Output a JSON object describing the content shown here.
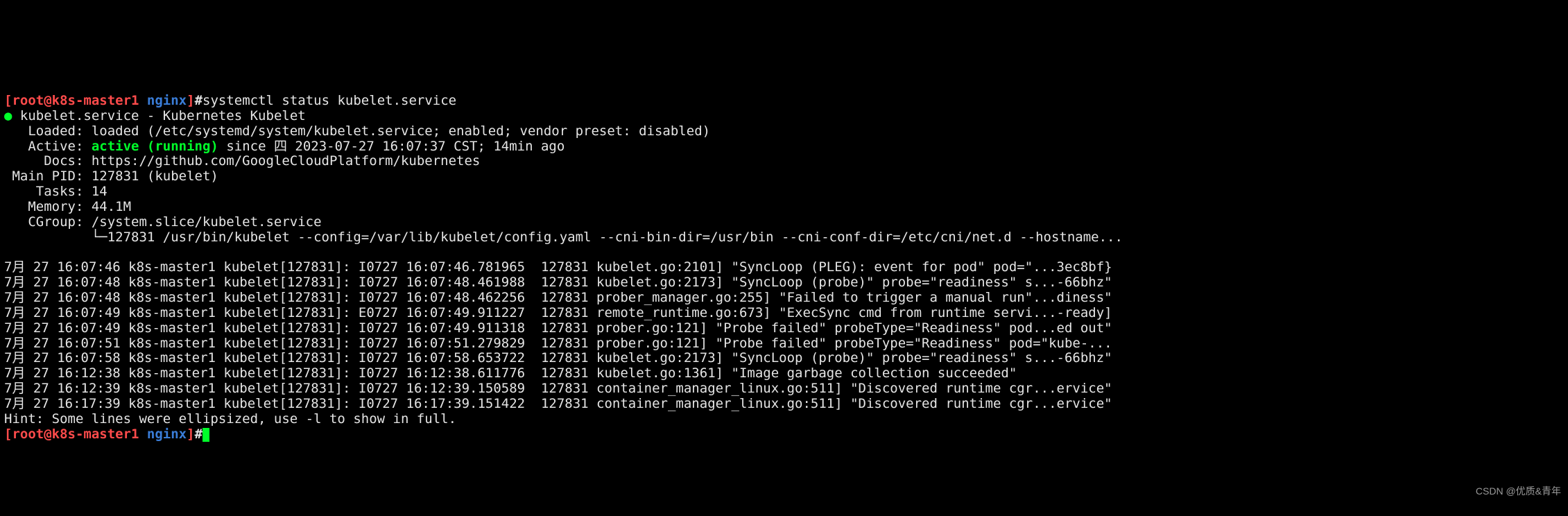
{
  "prompt": {
    "open": "[",
    "user_host": "root@k8s-master1",
    "cwd": " nginx",
    "close": "]",
    "hash": "#"
  },
  "command": "systemctl status kubelet.service",
  "status": {
    "bullet": "●",
    "service_header": " kubelet.service - Kubernetes Kubelet",
    "loaded_line": "   Loaded: loaded (/etc/systemd/system/kubelet.service; enabled; vendor preset: disabled)",
    "active_prefix": "   Active: ",
    "active_value": "active (running)",
    "active_suffix": " since 四 2023-07-27 16:07:37 CST; 14min ago",
    "docs_line": "     Docs: https://github.com/GoogleCloudPlatform/kubernetes",
    "main_pid_line": " Main PID: 127831 (kubelet)",
    "tasks_line": "    Tasks: 14",
    "memory_line": "   Memory: 44.1M",
    "cgroup_line": "   CGroup: /system.slice/kubelet.service",
    "cgroup_child": "           └─127831 /usr/bin/kubelet --config=/var/lib/kubelet/config.yaml --cni-bin-dir=/usr/bin --cni-conf-dir=/etc/cni/net.d --hostname..."
  },
  "log": {
    "l0": "7月 27 16:07:46 k8s-master1 kubelet[127831]: I0727 16:07:46.781965  127831 kubelet.go:2101] \"SyncLoop (PLEG): event for pod\" pod=\"...3ec8bf}",
    "l1": "7月 27 16:07:48 k8s-master1 kubelet[127831]: I0727 16:07:48.461988  127831 kubelet.go:2173] \"SyncLoop (probe)\" probe=\"readiness\" s...-66bhz\"",
    "l2": "7月 27 16:07:48 k8s-master1 kubelet[127831]: I0727 16:07:48.462256  127831 prober_manager.go:255] \"Failed to trigger a manual run\"...diness\"",
    "l3": "7月 27 16:07:49 k8s-master1 kubelet[127831]: E0727 16:07:49.911227  127831 remote_runtime.go:673] \"ExecSync cmd from runtime servi...-ready]",
    "l4": "7月 27 16:07:49 k8s-master1 kubelet[127831]: I0727 16:07:49.911318  127831 prober.go:121] \"Probe failed\" probeType=\"Readiness\" pod...ed out\"",
    "l5": "7月 27 16:07:51 k8s-master1 kubelet[127831]: I0727 16:07:51.279829  127831 prober.go:121] \"Probe failed\" probeType=\"Readiness\" pod=\"kube-...",
    "l6": "7月 27 16:07:58 k8s-master1 kubelet[127831]: I0727 16:07:58.653722  127831 kubelet.go:2173] \"SyncLoop (probe)\" probe=\"readiness\" s...-66bhz\"",
    "l7": "7月 27 16:12:38 k8s-master1 kubelet[127831]: I0727 16:12:38.611776  127831 kubelet.go:1361] \"Image garbage collection succeeded\"",
    "l8": "7月 27 16:12:39 k8s-master1 kubelet[127831]: I0727 16:12:39.150589  127831 container_manager_linux.go:511] \"Discovered runtime cgr...ervice\"",
    "l9": "7月 27 16:17:39 k8s-master1 kubelet[127831]: I0727 16:17:39.151422  127831 container_manager_linux.go:511] \"Discovered runtime cgr...ervice\""
  },
  "hint": "Hint: Some lines were ellipsized, use -l to show in full.",
  "watermark": "CSDN @优质&青年"
}
